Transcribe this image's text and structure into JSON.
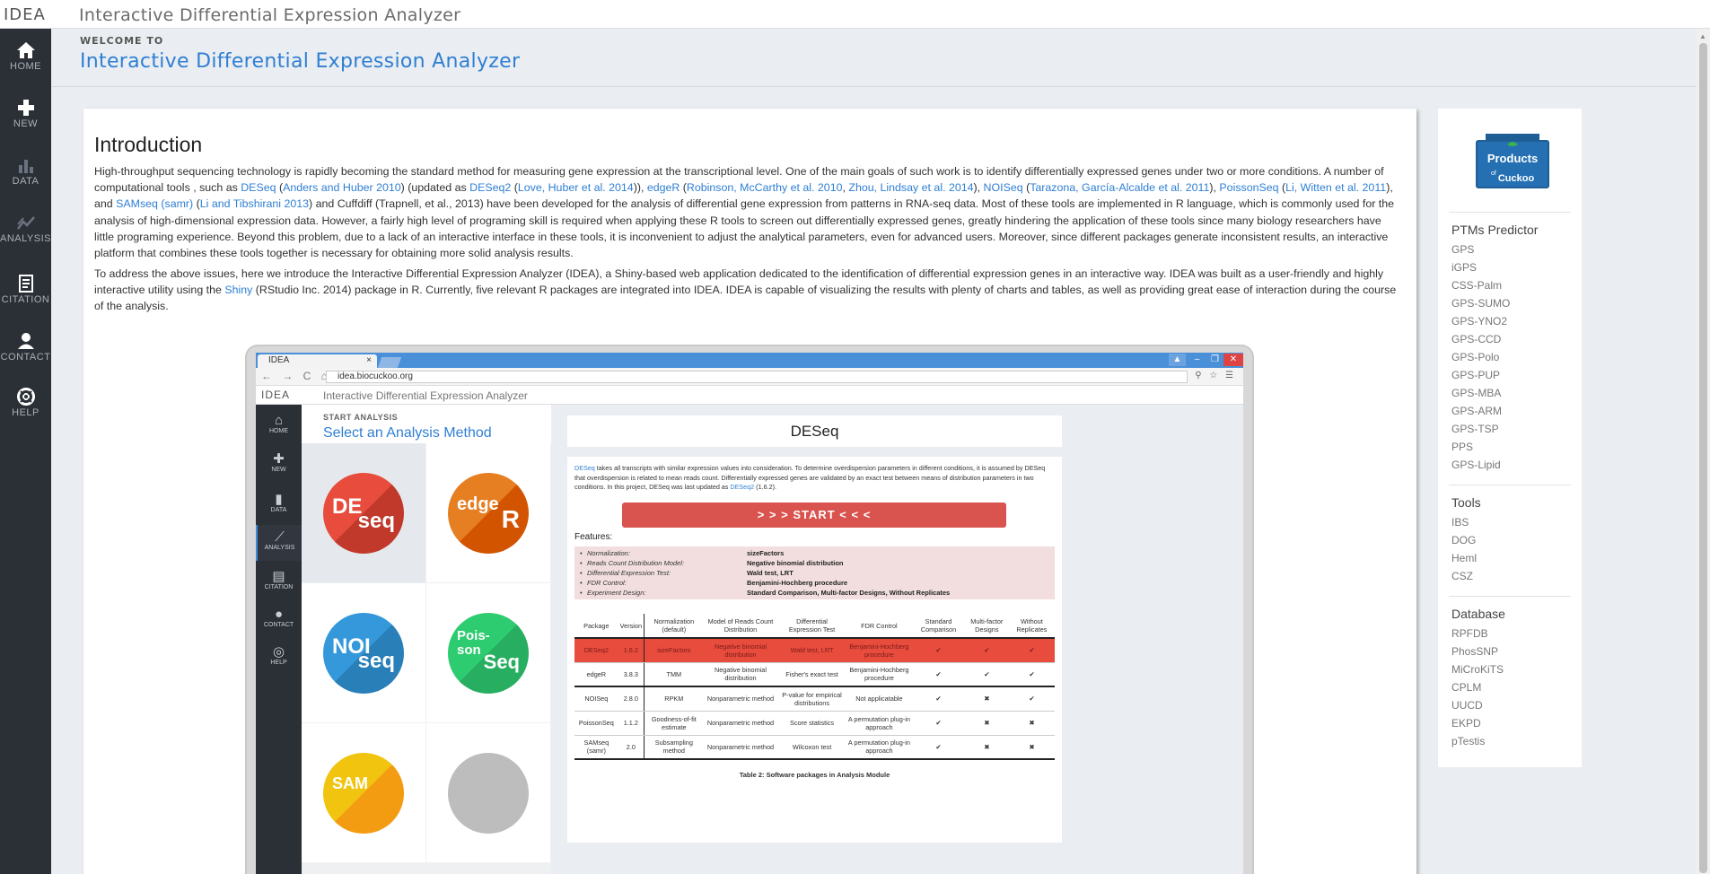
{
  "app": {
    "logo": "IDEA",
    "title": "Interactive Differential Expression Analyzer"
  },
  "sidebar": {
    "items": [
      {
        "label": "HOME",
        "icon": "home-icon"
      },
      {
        "label": "NEW",
        "icon": "plus-icon"
      },
      {
        "label": "DATA",
        "icon": "bar-chart-icon"
      },
      {
        "label": "ANALYSIS",
        "icon": "line-chart-icon"
      },
      {
        "label": "CITATION",
        "icon": "document-icon"
      },
      {
        "label": "CONTACT",
        "icon": "user-icon"
      },
      {
        "label": "HELP",
        "icon": "lifebuoy-icon"
      }
    ]
  },
  "header": {
    "welcome": "WELCOME TO",
    "heading": "Interactive Differential Expression Analyzer"
  },
  "intro": {
    "heading": "Introduction",
    "p1": {
      "t0": "High-throughput sequencing technology is rapidly becoming the standard method for measuring gene expression at the transcriptional level. One of the main goals of such work is to identify differentially expressed genes under two or more conditions. A number of computational tools , such as ",
      "l0": "DESeq",
      "t1": " (",
      "l1": "Anders and Huber 2010",
      "t2": ") (updated as ",
      "l2": "DESeq2",
      "t3": " (",
      "l3": "Love, Huber et al. 2014",
      "t4": ")), ",
      "l4": "edgeR",
      "t5": " (",
      "l5": "Robinson, McCarthy et al. 2010",
      "t6": ", ",
      "l6": "Zhou, Lindsay et al. 2014",
      "t7": "), ",
      "l7": "NOISeq",
      "t8": " (",
      "l8": "Tarazona, García-Alcalde et al. 2011",
      "t9": "), ",
      "l9": "PoissonSeq",
      "t10": " (",
      "l10": "Li, Witten et al. 2011",
      "t11": "), and ",
      "l11": "SAMseq (samr)",
      "t12": " (",
      "l12": "Li and Tibshirani 2013",
      "t13": ") and Cuffdiff (Trapnell, et al., 2013) have been developed for the analysis of differential gene expression from patterns in RNA-seq data. Most of these tools are implemented in R language, which is commonly used for the analysis of high-dimensional expression data. However, a fairly high level of programing skill is required when applying these R tools to screen out differentially expressed genes, greatly hindering the application of these tools since many biology researchers have little programing experience. Beyond this problem, due to a lack of an interactive interface in these tools, it is inconvenient to adjust the analytical parameters, even for advanced users. Moreover, since different packages generate inconsistent results, an interactive platform that combines these tools together is necessary for obtaining more solid analysis results."
    },
    "p2": {
      "t0": "To address the above issues, here we introduce the Interactive Differential Expression Analyzer (IDEA), a Shiny-based web application dedicated to the identification of differential expression genes in an interactive way. IDEA was built as a user-friendly and highly interactive utility using the ",
      "l0": "Shiny",
      "t1": " (RStudio Inc. 2014) package in R. Currently, five relevant R packages are integrated into IDEA. IDEA is capable of visualizing the results with plenty of charts and tables, as well as providing great ease of interaction during the course of the analysis."
    }
  },
  "embedded": {
    "tab_title": "IDEA",
    "tab_close": "×",
    "url": "idea.biocuckoo.org",
    "logo": "IDEA",
    "app_title": "Interactive Differential Expression Analyzer",
    "nav": [
      "HOME",
      "NEW",
      "DATA",
      "ANALYSIS",
      "CITATION",
      "CONTACT",
      "HELP"
    ],
    "start_label": "START ANALYSIS",
    "select_label": "Select an Analysis Method",
    "tiles": [
      {
        "a": "DE",
        "b": "seq",
        "color": "#e74c3c"
      },
      {
        "a": "edge",
        "b": "R",
        "color": "#e67e22"
      },
      {
        "a": "NOI",
        "b": "seq",
        "color": "#3498db"
      },
      {
        "a": "Pois-son",
        "b": "Seq",
        "color": "#2ecc71"
      },
      {
        "a": "SAM",
        "b": "",
        "color": "#f1c40f"
      },
      {
        "a": "",
        "b": "",
        "color": "#bdbdbd"
      }
    ],
    "method_title": "DESeq",
    "desc": {
      "l0": "DESeq",
      "t0": " takes all transcripts with similar expression values into consideration. To determine overdispersion parameters in different conditions, it is assumed by DESeq that overdispersion is related to mean reads count. Differentially expressed genes are validated by an exact test between means of distribution parameters in two conditions. In this project, DESeq was last updated as ",
      "l1": "DESeq2",
      "t1": " (1.6.2)."
    },
    "start_button": "> > > START < < <",
    "features_label": "Features:",
    "features": [
      {
        "k": "Normalization:",
        "v": "sizeFactors"
      },
      {
        "k": "Reads Count Distribution Model:",
        "v": "Negative binomial distribution"
      },
      {
        "k": "Differential Expression Test:",
        "v": "Wald test, LRT"
      },
      {
        "k": "FDR Control:",
        "v": "Benjamini-Hochberg procedure"
      },
      {
        "k": "Experiment Design:",
        "v": "Standard Comparison, Multi-factor Designs, Without Replicates"
      }
    ],
    "table": {
      "headers": [
        "Package",
        "Version",
        "Normalization (default)",
        "Model of Reads Count Distribution",
        "Differential Expression Test",
        "FDR Control",
        "Standard Comparison",
        "Multi-factor Designs",
        "Without Replicates"
      ],
      "rows": [
        [
          "DESeq2",
          "1.6.2",
          "sizeFactors",
          "Negative binomial distribution",
          "Wald test, LRT",
          "Benjamini-Hochberg procedure",
          "✔",
          "✔",
          "✔"
        ],
        [
          "edgeR",
          "3.8.3",
          "TMM",
          "Negative binomial distribution",
          "Fisher's exact test",
          "Benjamini-Hochberg procedure",
          "✔",
          "✔",
          "✔"
        ],
        [
          "NOISeq",
          "2.8.0",
          "RPKM",
          "Nonparametric method",
          "P-value for empirical distributions",
          "Not applicatable",
          "✔",
          "✖",
          "✔"
        ],
        [
          "PoissonSeq",
          "1.1.2",
          "Goodness-of-fit estimate",
          "Nonparametric method",
          "Score statistics",
          "A permutation plug-in approach",
          "✔",
          "✖",
          "✖"
        ],
        [
          "SAMseq (samr)",
          "2.0",
          "Subsampling method",
          "Nonparametric method",
          "Wilcoxon test",
          "A permutation plug-in approach",
          "✔",
          "✖",
          "✖"
        ]
      ]
    },
    "caption": "Table 2: Software packages in Analysis Module"
  },
  "right_panel": {
    "logo_line1": "Products",
    "logo_line2": "of",
    "logo_line3": "Cuckoo",
    "sections": [
      {
        "title": "PTMs Predictor",
        "links": [
          "GPS",
          "iGPS",
          "CSS-Palm",
          "GPS-SUMO",
          "GPS-YNO2",
          "GPS-CCD",
          "GPS-Polo",
          "GPS-PUP",
          "GPS-MBA",
          "GPS-ARM",
          "GPS-TSP",
          "PPS",
          "GPS-Lipid"
        ]
      },
      {
        "title": "Tools",
        "links": [
          "IBS",
          "DOG",
          "Heml",
          "CSZ"
        ]
      },
      {
        "title": "Database",
        "links": [
          "RPFDB",
          "PhosSNP",
          "MiCroKiTS",
          "CPLM",
          "UUCD",
          "EKPD",
          "pTestis"
        ]
      }
    ]
  },
  "colors": {
    "accent": "#2f7fd3",
    "sidebar": "#2b2f36",
    "danger": "#d9534f"
  }
}
